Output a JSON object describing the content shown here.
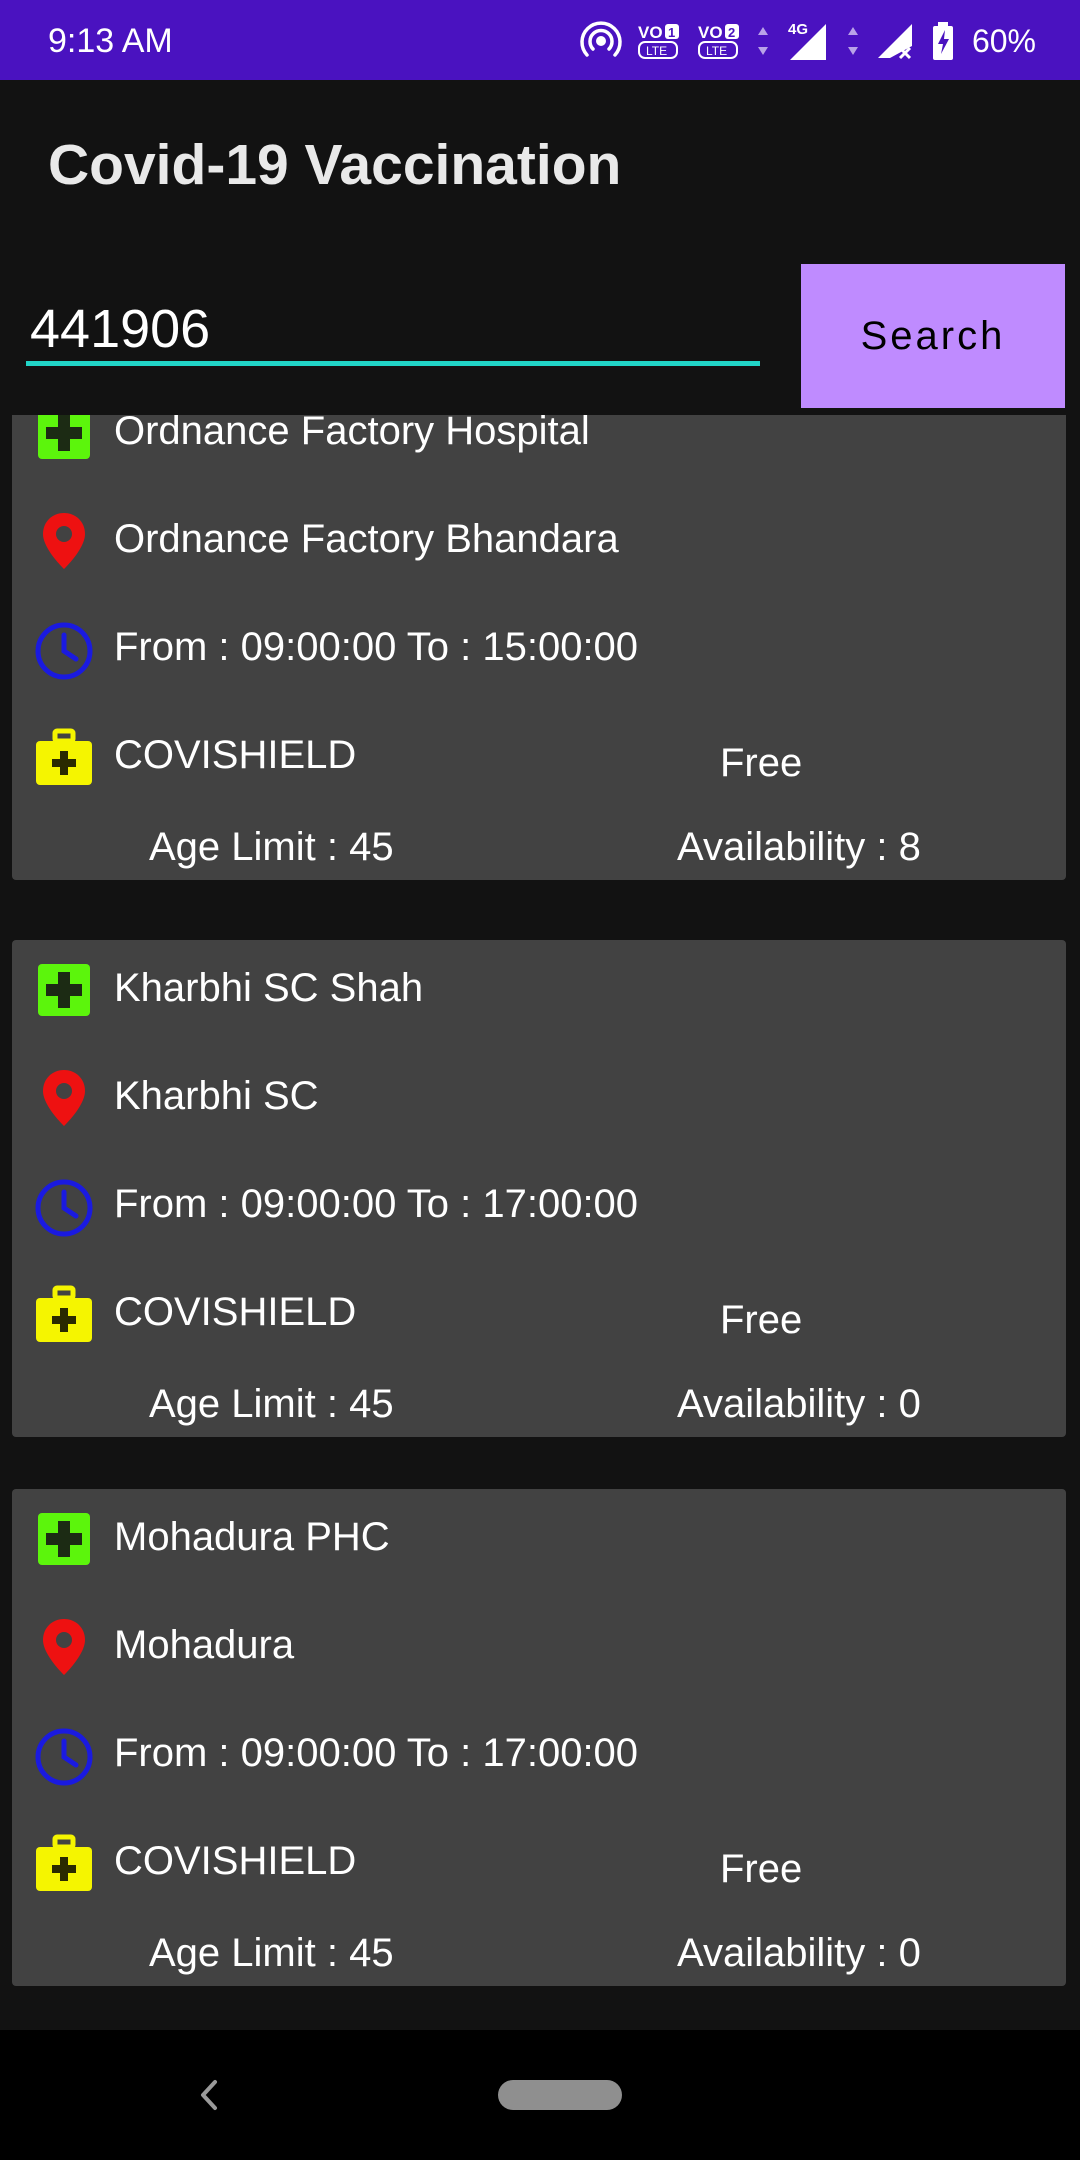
{
  "status_bar": {
    "time": "9:13 AM",
    "battery": "60%",
    "net_label": "4G",
    "sim1": "VO",
    "sim2": "VO",
    "lte": "LTE",
    "icons": [
      "hotspot-icon",
      "volte1-icon",
      "volte2-icon",
      "signal-4g-icon",
      "signal-no-service-icon",
      "battery-charging-icon"
    ],
    "background": "#4a12c0"
  },
  "app": {
    "title": "Covid-19 Vaccination",
    "search": {
      "value": "441906",
      "button_label": "Search"
    }
  },
  "centers": [
    {
      "name": "Ordnance Factory Hospital",
      "address": "Ordnance Factory Bhandara",
      "timing": "From : 09:00:00 To : 15:00:00",
      "vaccine": "COVISHIELD",
      "fee": "Free",
      "age_limit": "Age Limit : 45",
      "availability": "Availability : 8"
    },
    {
      "name": "Kharbhi SC Shah",
      "address": "Kharbhi SC",
      "timing": "From : 09:00:00 To : 17:00:00",
      "vaccine": "COVISHIELD",
      "fee": "Free",
      "age_limit": "Age Limit : 45",
      "availability": "Availability : 0"
    },
    {
      "name": "Mohadura PHC",
      "address": "Mohadura",
      "timing": "From : 09:00:00 To : 17:00:00",
      "vaccine": "COVISHIELD",
      "fee": "Free",
      "age_limit": "Age Limit : 45",
      "availability": "Availability : 0"
    }
  ],
  "icon_colors": {
    "hospital": "#5cf50c",
    "location": "#ee1111",
    "clock": "#1a1ae0",
    "vaccine": "#f5f500"
  },
  "icons": [
    "hospital-icon",
    "location-pin-icon",
    "clock-icon",
    "medical-kit-icon"
  ],
  "nav": {
    "back_icon": "back-chevron-icon",
    "home_icon": "home-pill-icon"
  }
}
